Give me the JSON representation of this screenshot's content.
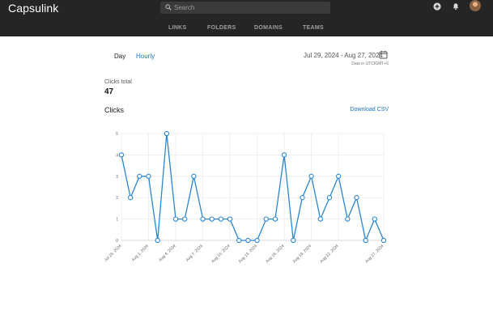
{
  "app": {
    "title": "Capsulink"
  },
  "search": {
    "placeholder": "Search"
  },
  "nav": {
    "items": [
      "LINKS",
      "FOLDERS",
      "DOMAINS",
      "TEAMS"
    ]
  },
  "header_icons": [
    "add-circle-icon",
    "bell-icon",
    "avatar"
  ],
  "filters": {
    "day": "Day",
    "hourly": "Hourly"
  },
  "date_range": {
    "label": "Jul 29, 2024 - Aug 27, 2024",
    "tz_note": "Data in UTC/GMT+0"
  },
  "stats": {
    "clicks_total_label": "Clicks total",
    "clicks_total_value": "47"
  },
  "section": {
    "title": "Clicks",
    "download": "Download CSV"
  },
  "colors": {
    "topbar": "#252525",
    "accent": "#1a73c8",
    "line": "#2a86d4",
    "grid": "#e6e6e6"
  },
  "chart_data": {
    "type": "line",
    "x_ticks": [
      "Jul 29, 2024",
      "Aug 1, 2024",
      "Aug 4, 2024",
      "Aug 7, 2024",
      "Aug 10, 2024",
      "Aug 13, 2024",
      "Aug 16, 2024",
      "Aug 19, 2024",
      "Aug 22, 2024",
      "Aug 27, 2024"
    ],
    "y_ticks": [
      0,
      1,
      2,
      3,
      4,
      5
    ],
    "ylim": [
      0,
      5
    ],
    "grid": true,
    "series": [
      {
        "values": [
          4,
          2,
          3,
          3,
          0,
          5,
          1,
          1,
          3,
          1,
          1,
          1,
          1,
          0,
          0,
          0,
          1,
          1,
          4,
          0,
          2,
          3,
          1,
          2,
          3,
          1,
          2,
          0,
          1,
          0
        ]
      }
    ]
  }
}
